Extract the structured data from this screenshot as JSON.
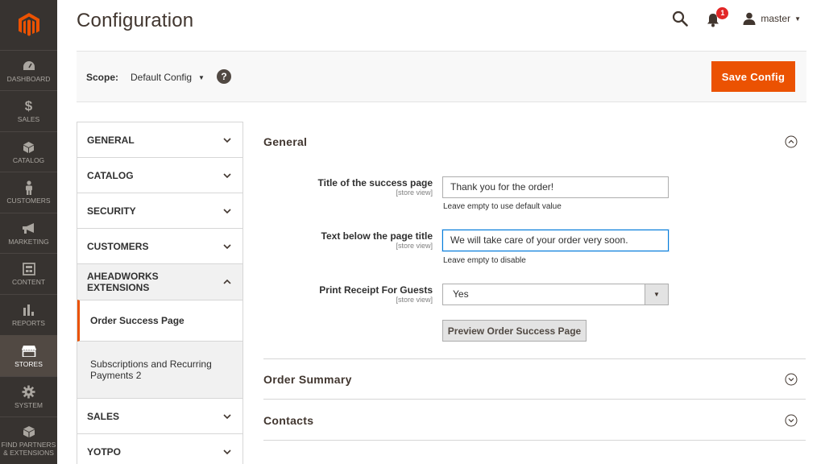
{
  "nav": {
    "items": [
      {
        "label": "DASHBOARD",
        "icon": "dashboard-icon"
      },
      {
        "label": "SALES",
        "icon": "dollar-icon"
      },
      {
        "label": "CATALOG",
        "icon": "cube-icon"
      },
      {
        "label": "CUSTOMERS",
        "icon": "person-icon"
      },
      {
        "label": "MARKETING",
        "icon": "megaphone-icon"
      },
      {
        "label": "CONTENT",
        "icon": "layout-icon"
      },
      {
        "label": "REPORTS",
        "icon": "bar-chart-icon"
      },
      {
        "label": "STORES",
        "icon": "storefront-icon"
      },
      {
        "label": "SYSTEM",
        "icon": "gear-icon"
      },
      {
        "label": "FIND PARTNERS & EXTENSIONS",
        "icon": "box-icon"
      }
    ],
    "active": "STORES"
  },
  "header": {
    "title": "Configuration",
    "notifications_count": "1",
    "user": "master"
  },
  "scope": {
    "label": "Scope:",
    "value": "Default Config",
    "help": "?"
  },
  "actions": {
    "save_label": "Save Config"
  },
  "tabs": {
    "general": "GENERAL",
    "catalog": "CATALOG",
    "security": "SECURITY",
    "customers": "CUSTOMERS",
    "aheadworks": "AHEADWORKS EXTENSIONS",
    "aheadworks_items": [
      "Order Success Page",
      "Subscriptions and Recurring Payments 2"
    ],
    "sales": "SALES",
    "yotpo": "YOTPO"
  },
  "sections": {
    "general": {
      "title": "General",
      "fields": {
        "title": {
          "label": "Title of the success page",
          "scope": "[store view]",
          "value": "Thank you for the order!",
          "note": "Leave empty to use default value"
        },
        "text": {
          "label": "Text below the page title",
          "scope": "[store view]",
          "value": "We will take care of your order very soon.",
          "note": "Leave empty to disable"
        },
        "receipt": {
          "label": "Print Receipt For Guests",
          "scope": "[store view]",
          "value": "Yes"
        }
      },
      "preview_label": "Preview Order Success Page"
    },
    "order_summary": {
      "title": "Order Summary"
    },
    "contacts": {
      "title": "Contacts"
    }
  },
  "colors": {
    "accent": "#eb5202",
    "nav_bg": "#373330",
    "nav_active": "#514943",
    "badge": "#e22626"
  }
}
